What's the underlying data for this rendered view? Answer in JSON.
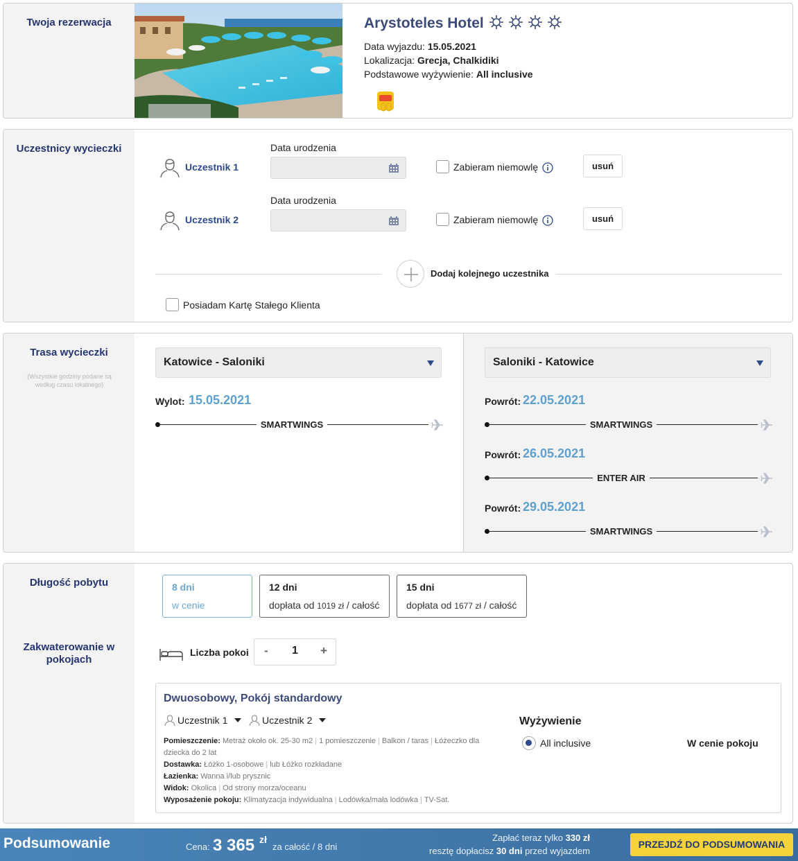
{
  "booking": {
    "section_title": "Twoja rezerwacja",
    "hotel_name": "Arystoteles Hotel",
    "stars": 4,
    "departure_label": "Data wyjazdu:",
    "departure_value": "15.05.2021",
    "location_label": "Lokalizacja:",
    "location_value": "Grecja, Chalkidiki",
    "board_label": "Podstawowe wyżywienie:",
    "board_value": "All inclusive",
    "badge_icon": "family-badge-icon"
  },
  "participants": {
    "section_title": "Uczestnicy wycieczki",
    "dob_label": "Data urodzenia",
    "infant_label": "Zabieram niemowlę",
    "remove_label": "usuń",
    "items": [
      {
        "name": "Uczestnik 1",
        "dob": "",
        "infant": false
      },
      {
        "name": "Uczestnik 2",
        "dob": "",
        "infant": false
      }
    ],
    "add_label": "Dodaj kolejnego uczestnika",
    "loyalty_label": "Posiadam Kartę Stałego Klienta",
    "loyalty_checked": false
  },
  "route": {
    "section_title": "Trasa wycieczki",
    "note": "(Wszystkie godziny podane są według czasu lokalnego)",
    "outbound": {
      "select_value": "Katowice - Saloniki",
      "label": "Wylot:",
      "date": "15.05.2021",
      "carrier": "SMARTWINGS"
    },
    "return": {
      "select_value": "Saloniki - Katowice",
      "options": [
        {
          "label": "Powrót:",
          "date": "22.05.2021",
          "carrier": "SMARTWINGS"
        },
        {
          "label": "Powrót:",
          "date": "26.05.2021",
          "carrier": "ENTER AIR"
        },
        {
          "label": "Powrót:",
          "date": "29.05.2021",
          "carrier": "SMARTWINGS"
        }
      ]
    }
  },
  "stay": {
    "section_title": "Długość pobytu",
    "options": [
      {
        "title": "8 dni",
        "subtitle": "w cenie",
        "selected": true
      },
      {
        "title": "12 dni",
        "prefix": "dopłata od",
        "amount": "1019 zł",
        "suffix": "/ całość",
        "selected": false
      },
      {
        "title": "15 dni",
        "prefix": "dopłata od",
        "amount": "1677 zł",
        "suffix": "/ całość",
        "selected": false
      }
    ]
  },
  "rooms": {
    "section_title": "Zakwaterowanie w pokojach",
    "count_label": "Liczba pokoi",
    "count": "1",
    "minus": "-",
    "plus": "+",
    "room": {
      "title": "Dwuosobowy, Pokój standardowy",
      "occupants": [
        "Uczestnik 1",
        "Uczestnik 2"
      ],
      "details": {
        "space_label": "Pomieszczenie:",
        "space_items": [
          "Metraż około ok. 25-30 m2",
          "1 pomieszczenie",
          "Balkon / taras",
          "Łóżeczko dla dziecka do 2 lat"
        ],
        "extra_label": "Dostawka:",
        "extra_items": [
          "Łóżko 1-osobowe",
          "lub Łóżko rozkładane"
        ],
        "bath_label": "Łazienka:",
        "bath_items": [
          "Wanna i/lub prysznic"
        ],
        "view_label": "Widok:",
        "view_items": [
          "Okolica",
          "Od strony morza/oceanu"
        ],
        "equip_label": "Wyposażenie pokoju:",
        "equip_items": [
          "Klimatyzacja indywidualna",
          "Lodówka/mała lodówka",
          "TV-Sat."
        ]
      },
      "board_heading": "Wyżywienie",
      "board_option": "All inclusive",
      "board_selected": true,
      "board_price": "W cenie pokoju"
    }
  },
  "summary": {
    "title": "Podsumowanie",
    "price_label": "Cena:",
    "price_amount": "3 365",
    "price_currency": "zł",
    "price_scope": "za całość / 8 dni",
    "pay_now_prefix": "Zapłać teraz tylko",
    "pay_now_amount": "330 zł",
    "rest_prefix": "resztę dopłacisz",
    "rest_days": "30 dni",
    "rest_suffix": "przed wyjazdem",
    "button_label": "PRZEJDŹ DO PODSUMOWANIA"
  },
  "colors": {
    "title_navy": "#24356f",
    "date_blue": "#5fa0cf",
    "summary_bar": "#4a85b9",
    "cta_yellow": "#f6d33a",
    "side_grey": "#f3f3f3"
  }
}
